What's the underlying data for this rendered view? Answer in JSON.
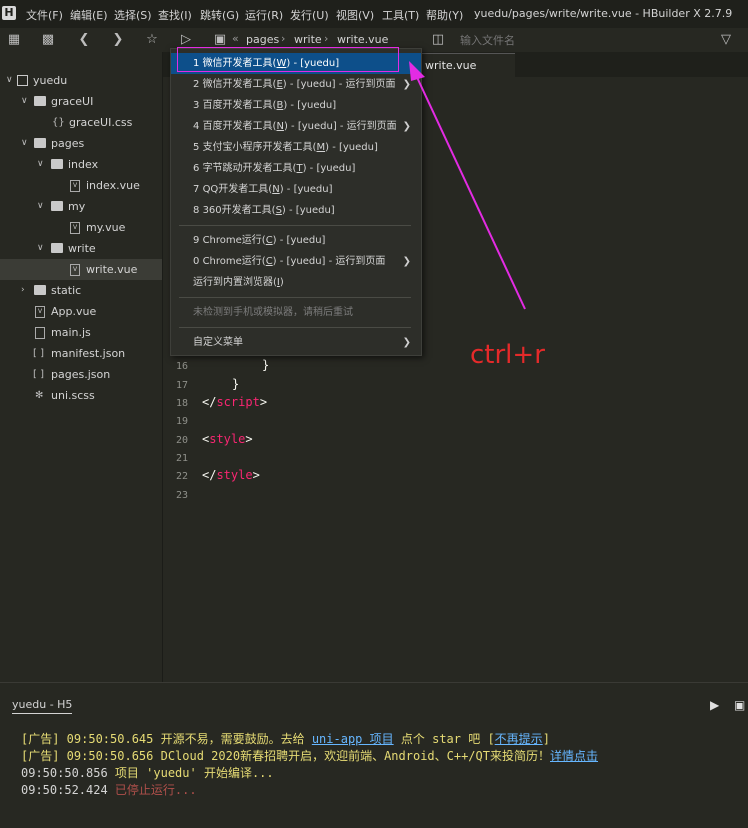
{
  "menubar": {
    "logo": "H",
    "items": [
      "文件(F)",
      "编辑(E)",
      "选择(S)",
      "查找(I)",
      "跳转(G)",
      "运行(R)",
      "发行(U)",
      "视图(V)",
      "工具(T)",
      "帮助(Y)"
    ],
    "title": "yuedu/pages/write/write.vue - HBuilder X 2.7.9"
  },
  "toolbar": {
    "breadcrumb": [
      "pages",
      "write",
      "write.vue"
    ],
    "file_input_placeholder": "输入文件名"
  },
  "sidebar": {
    "root": "yuedu",
    "items": [
      {
        "label": "graceUI"
      },
      {
        "label": "graceUI.css"
      },
      {
        "label": "pages"
      },
      {
        "label": "index"
      },
      {
        "label": "index.vue"
      },
      {
        "label": "my"
      },
      {
        "label": "my.vue"
      },
      {
        "label": "write"
      },
      {
        "label": "write.vue"
      },
      {
        "label": "static"
      },
      {
        "label": "App.vue"
      },
      {
        "label": "main.js"
      },
      {
        "label": "manifest.json"
      },
      {
        "label": "pages.json"
      },
      {
        "label": "uni.scss"
      }
    ]
  },
  "editor": {
    "tab": "write.vue",
    "lines": [
      {
        "n": "16",
        "code": "}"
      },
      {
        "n": "17",
        "code": "}"
      },
      {
        "n": "18",
        "open": "</",
        "tag": "script",
        "close": ">"
      },
      {
        "n": "19"
      },
      {
        "n": "20",
        "open": "<",
        "tag": "style",
        "close": ">"
      },
      {
        "n": "21"
      },
      {
        "n": "22",
        "open": "</",
        "tag": "style",
        "close": ">"
      },
      {
        "n": "23"
      }
    ]
  },
  "dropdown": {
    "items": [
      {
        "num": "1",
        "text": "微信开发者工具(",
        "key": "W",
        "rest": ") - [yuedu]"
      },
      {
        "num": "2",
        "text": "微信开发者工具(",
        "key": "E",
        "rest": ") - [yuedu] - 运行到页面"
      },
      {
        "num": "3",
        "text": "百度开发者工具(",
        "key": "B",
        "rest": ") - [yuedu]"
      },
      {
        "num": "4",
        "text": "百度开发者工具(",
        "key": "N",
        "rest": ") - [yuedu] - 运行到页面"
      },
      {
        "num": "5",
        "text": "支付宝小程序开发者工具(",
        "key": "M",
        "rest": ") - [yuedu]"
      },
      {
        "num": "6",
        "text": "字节跳动开发者工具(",
        "key": "T",
        "rest": ") - [yuedu]"
      },
      {
        "num": "7",
        "text": "QQ开发者工具(",
        "key": "N",
        "rest": ") - [yuedu]"
      },
      {
        "num": "8",
        "text": "360开发者工具(",
        "key": "S",
        "rest": ") - [yuedu]"
      },
      {
        "num": "9",
        "text": "Chrome运行(",
        "key": "C",
        "rest": ") - [yuedu]"
      },
      {
        "num": "0",
        "text": "Chrome运行(",
        "key": "C",
        "rest": ") - [yuedu] - 运行到页面"
      },
      {
        "text": "运行到内置浏览器(",
        "key": "I",
        "rest": ")"
      },
      {
        "text": "未检测到手机或模拟器，请稍后重试"
      },
      {
        "text": "自定义菜单"
      }
    ]
  },
  "annotation": {
    "text": "ctrl+r",
    "color": "#e52a2a",
    "highlight_color": "#e32be3"
  },
  "console": {
    "tab": "yuedu - H5",
    "lines": [
      {
        "prefix": "[广告] 09:50:50.645 开源不易，需要鼓励。去给 ",
        "link": "uni-app 项目",
        "mid": " 点个 star 吧 [",
        "link2": "不再提示",
        "suffix": "]"
      },
      {
        "prefix": "[广告] 09:50:50.656 DCloud 2020新春招聘开启，欢迎前端、Android、C++/QT来投简历！",
        "link": "详情点击"
      },
      {
        "time": "09:50:50.856 ",
        "text": "项目 'yuedu' 开始编译..."
      },
      {
        "time": "09:50:52.424 ",
        "text": "已停止运行..."
      }
    ]
  }
}
